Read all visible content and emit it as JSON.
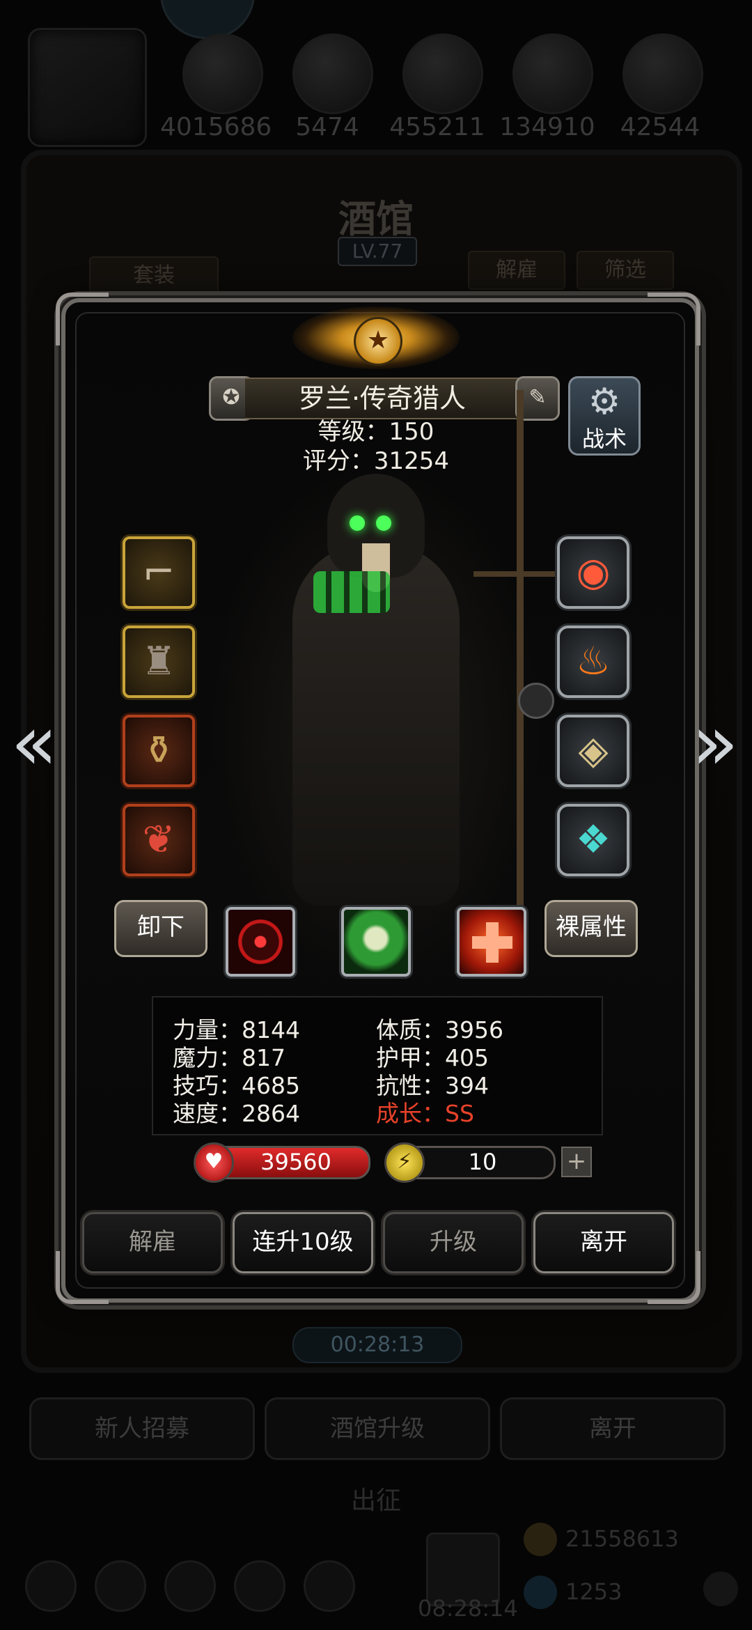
{
  "background": {
    "resources": [
      "4015686",
      "5474",
      "455211",
      "134910",
      "42544"
    ],
    "tavern_title": "酒馆",
    "tavern_level": "LV.77",
    "set_button": "套装",
    "dismiss_button": "解雇",
    "filter_button": "筛选",
    "timer": "00:28:13",
    "recruit_button": "新人招募",
    "upgrade_tavern_button": "酒馆升级",
    "leave_button": "离开",
    "expedition_label": "出征",
    "bottom_timer": "08:28:14",
    "gold": "21558613",
    "gems": "1253"
  },
  "hero": {
    "name": "罗兰·传奇猎人",
    "level_line": "等级：150",
    "score_line": "评分：31254",
    "tactics_label": "战术",
    "unequip_button": "卸下",
    "bare_stats_button": "裸属性",
    "stats": {
      "strength": "力量：8144",
      "magic": "魔力：817",
      "skill": "技巧：4685",
      "speed": "速度：2864",
      "constitution": "体质：3956",
      "armor": "护甲：405",
      "resistance": "抗性：394",
      "growth": "成长：SS"
    },
    "hp": "39560",
    "energy": "10",
    "energy_fraction": 0.1,
    "left_equipment_icons": [
      "revolver-icon",
      "coat-icon",
      "bottle-icon",
      "charm-icon"
    ],
    "right_equipment_icons": [
      "orb-icon",
      "flame-icon",
      "shield-fragment-icon",
      "gem-cube-icon"
    ],
    "skill_icons": [
      "crosshair-skill-icon",
      "skull-skill-icon",
      "heal-cross-skill-icon"
    ]
  },
  "actions": {
    "dismiss": "解雇",
    "level_up_10": "连升10级",
    "level_up": "升级",
    "leave": "离开"
  },
  "colors": {
    "growth": "#e8422a",
    "hp": "#e02a2a",
    "energy": "#e8d23a"
  }
}
